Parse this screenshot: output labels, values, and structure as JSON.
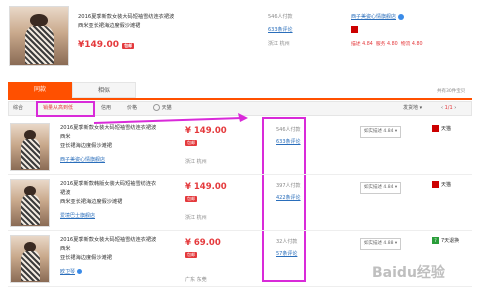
{
  "top_product": {
    "title_line1": "2016夏季新款女装大码短袖雪纺连衣裙波",
    "title_line2": "西米亚长裙海边度假沙滩裙",
    "price": "¥149.00",
    "tag": "包邮",
    "sold": "546人付款",
    "reviews": "633条评论",
    "location": "浙江 杭州",
    "shop": "西子美姿心情旗舰店",
    "rating_desc": "描述 4.84",
    "rating_service": "服务 4.80",
    "rating_logistics": "物流 4.80"
  },
  "tabs": [
    {
      "label": "同款",
      "active": true
    },
    {
      "label": "相似",
      "active": false
    }
  ],
  "filters": {
    "comprehensive": "综合",
    "sales_credit": "销量从高到低",
    "credit": "信用",
    "price": "价格",
    "tmall": "天猫",
    "ship_from": "发货地",
    "page": "1/1",
    "total": "共有30件宝贝"
  },
  "results": [
    {
      "title_line1": "2016夏季新款女装大码短袖雪纺连衣裙波西米",
      "title_line2": "亚长裙海边度假沙滩裙",
      "price": "¥ 149.00",
      "tag": "包邮",
      "shop": "西子美姿心情旗舰店",
      "location": "浙江 杭州",
      "sold": "546人付款",
      "reviews": "633条评论",
      "shipping": "如实描述 4.84",
      "badge_label": "天猫"
    },
    {
      "title_line1": "2016夏季新款韩版女装大码短袖雪纺连衣裙波",
      "title_line2": "西米亚长裙海边度假沙滩裙",
      "price": "¥ 149.00",
      "tag": "包邮",
      "shop": "爱境巴士旗舰店",
      "location": "浙江 杭州",
      "sold": "397人付款",
      "reviews": "422条评论",
      "shipping": "如实描述 4.84",
      "badge_label": "天猫"
    },
    {
      "title_line1": "2016夏季新款女装大码短袖雪纺连衣裙波西米",
      "title_line2": "亚长裙海边度假沙滩裙",
      "price": "¥ 69.00",
      "tag": "包邮",
      "shop": "欧卫琴",
      "location": "广东 东莞",
      "sold": "32人付款",
      "reviews": "57条评论",
      "shipping": "如实描述 4.88",
      "badge_label": "7天退换"
    }
  ],
  "watermark": "Baidu经验"
}
